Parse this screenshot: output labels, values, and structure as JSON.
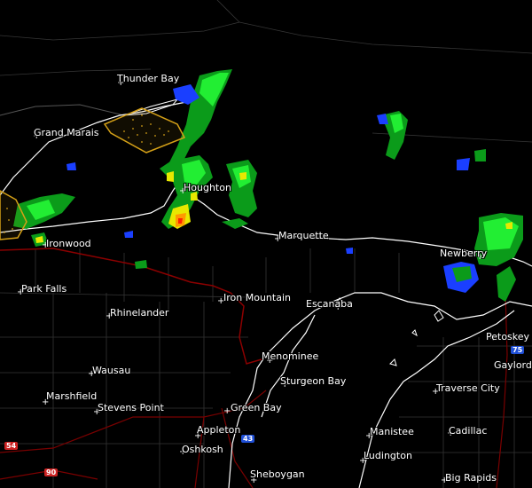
{
  "map": {
    "colors": {
      "background": "#000000",
      "shoreline": "#ffffff",
      "state_border": "#8b0000",
      "county_line": "#3a3a3a",
      "highway": "#7a0000",
      "warning_polygon": "#d4a017",
      "radar_light_green": "#22ee33",
      "radar_green": "#0b9b1a",
      "radar_yellow": "#e8e800",
      "radar_orange": "#ff9900",
      "radar_red": "#ff2200",
      "radar_blue": "#1a3fff",
      "radar_cyan": "#44d8ff"
    },
    "cities": [
      {
        "id": "thunder-bay",
        "name": "Thunder Bay"
      },
      {
        "id": "grand-marais",
        "name": "Grand Marais"
      },
      {
        "id": "houghton",
        "name": "Houghton"
      },
      {
        "id": "ironwood",
        "name": "Ironwood"
      },
      {
        "id": "marquette",
        "name": "Marquette"
      },
      {
        "id": "newberry",
        "name": "Newberry"
      },
      {
        "id": "park-falls",
        "name": "Park Falls"
      },
      {
        "id": "iron-mountain",
        "name": "Iron Mountain"
      },
      {
        "id": "rhinelander",
        "name": "Rhinelander"
      },
      {
        "id": "escanaba",
        "name": "Escanaba"
      },
      {
        "id": "petoskey",
        "name": "Petoskey"
      },
      {
        "id": "wausau",
        "name": "Wausau"
      },
      {
        "id": "menominee",
        "name": "Menominee"
      },
      {
        "id": "gaylord",
        "name": "Gaylord"
      },
      {
        "id": "sturgeon-bay",
        "name": "Sturgeon Bay"
      },
      {
        "id": "traverse-city",
        "name": "Traverse City"
      },
      {
        "id": "marshfield",
        "name": "Marshfield"
      },
      {
        "id": "stevens-point",
        "name": "Stevens Point"
      },
      {
        "id": "green-bay",
        "name": "Green Bay"
      },
      {
        "id": "appleton",
        "name": "Appleton"
      },
      {
        "id": "manistee",
        "name": "Manistee"
      },
      {
        "id": "cadillac",
        "name": "Cadillac"
      },
      {
        "id": "oshkosh",
        "name": "Oshkosh"
      },
      {
        "id": "ludington",
        "name": "Ludington"
      },
      {
        "id": "sheboygan",
        "name": "Sheboygan"
      },
      {
        "id": "big-rapids",
        "name": "Big Rapids"
      }
    ],
    "shields": [
      {
        "id": "i75",
        "label": "75",
        "color": "#1f4fd6"
      },
      {
        "id": "i43",
        "label": "43",
        "color": "#1f4fd6"
      },
      {
        "id": "us54",
        "label": "54",
        "color": "#cc2222"
      },
      {
        "id": "i90",
        "label": "90",
        "color": "#cc2222"
      }
    ]
  }
}
